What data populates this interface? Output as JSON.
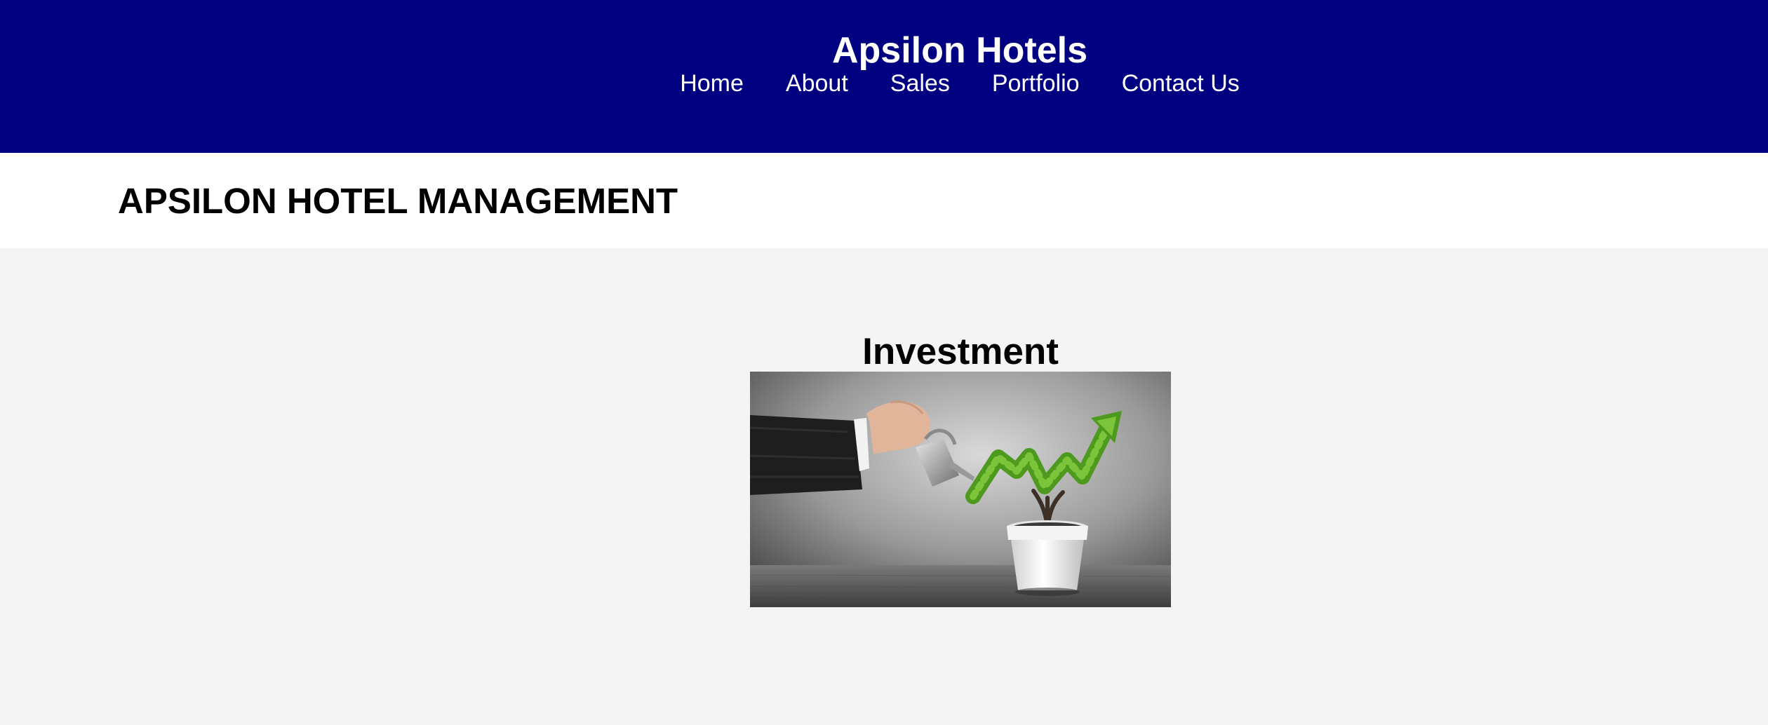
{
  "header": {
    "site_title": "Apsilon Hotels",
    "background_color": "#000080",
    "nav": [
      {
        "label": "Home"
      },
      {
        "label": "About"
      },
      {
        "label": "Sales"
      },
      {
        "label": "Portfolio"
      },
      {
        "label": "Contact Us"
      }
    ]
  },
  "banner": {
    "heading": "APSILON HOTEL MANAGEMENT"
  },
  "main": {
    "section_heading": "Investment",
    "image": {
      "subject": "hand-watering-plant-growth-arrow-image"
    }
  }
}
